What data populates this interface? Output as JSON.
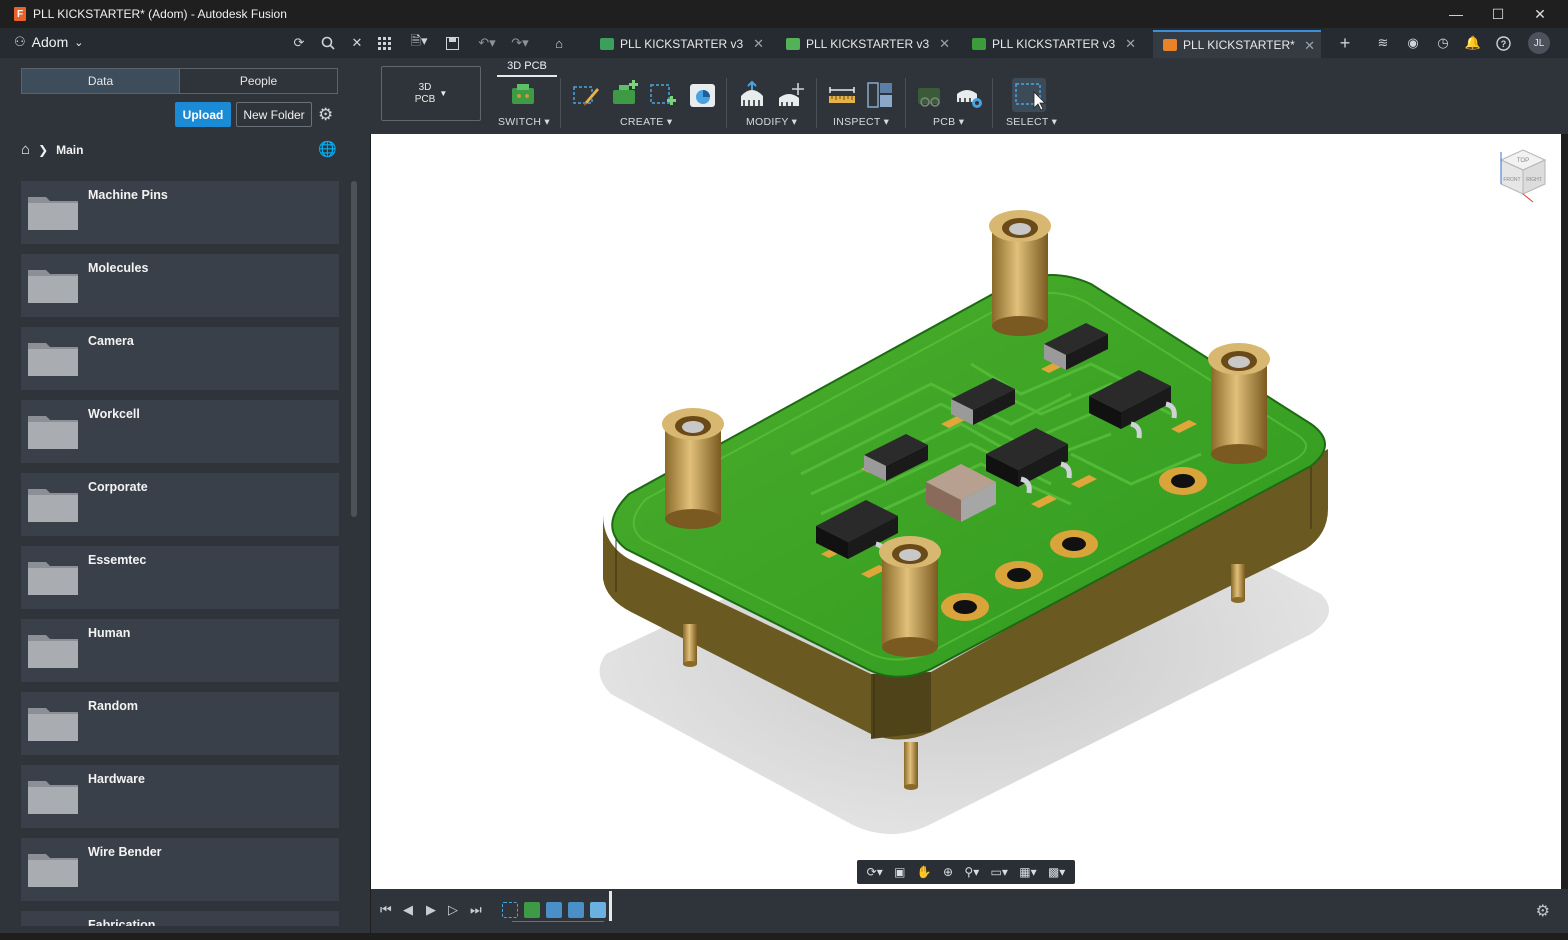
{
  "window": {
    "title": "PLL KICKSTARTER* (Adom) - Autodesk Fusion",
    "minimize": "—",
    "maximize": "☐",
    "close": "✕"
  },
  "appbar": {
    "team": "Adom",
    "tabs": [
      {
        "label": "PLL KICKSTARTER v3",
        "active": false
      },
      {
        "label": "PLL KICKSTARTER v3",
        "active": false
      },
      {
        "label": "PLL KICKSTARTER v3",
        "active": false
      },
      {
        "label": "PLL KICKSTARTER*",
        "active": true
      }
    ],
    "user_initials": "JL"
  },
  "datapanel": {
    "segments": [
      "Data",
      "People"
    ],
    "active_segment": "Data",
    "upload_label": "Upload",
    "new_folder_label": "New Folder",
    "breadcrumb": "Main",
    "folders": [
      "Machine Pins",
      "Molecules",
      "Camera",
      "Workcell",
      "Corporate",
      "Essemtec",
      "Human",
      "Random",
      "Hardware",
      "Wire Bender",
      "Fabrication"
    ]
  },
  "toolbar": {
    "workspace": "3D\nPCB",
    "workspace_tab": "3D PCB",
    "groups": [
      "SWITCH",
      "CREATE",
      "MODIFY",
      "INSPECT",
      "PCB",
      "SELECT"
    ]
  },
  "viewcube": {
    "top": "TOP",
    "front": "FRONT",
    "right": "RIGHT"
  },
  "colors": {
    "accent": "#1c8bd6",
    "panel": "#2f343b",
    "board_green": "#2f9a1f",
    "gold": "#c89a3a"
  }
}
